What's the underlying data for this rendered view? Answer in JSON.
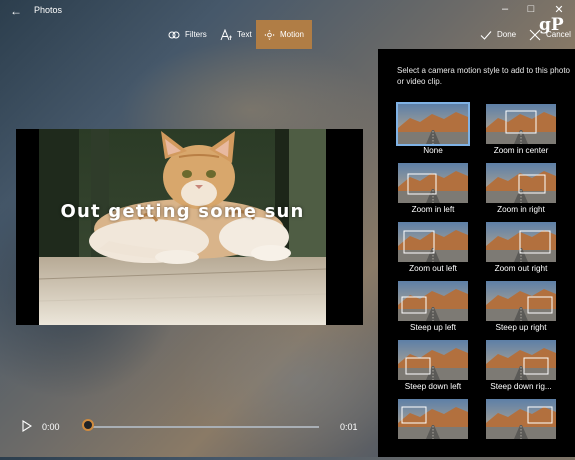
{
  "window": {
    "title": "Photos"
  },
  "toolbar": {
    "filters_label": "Filters",
    "text_label": "Text",
    "motion_label": "Motion",
    "done_label": "Done",
    "cancel_label": "Cancel",
    "accent_color": "#b07d45"
  },
  "watermark": "gP",
  "preview": {
    "caption": "Out getting some sun"
  },
  "player": {
    "current_time": "0:00",
    "total_time": "0:01",
    "progress": 0,
    "accent_color": "#d08b3e"
  },
  "motion_panel": {
    "description": "Select a camera motion style to add to this photo or video clip.",
    "options": [
      {
        "label": "None",
        "frame": "none"
      },
      {
        "label": "Zoom in center",
        "frame": "zoom-in-center"
      },
      {
        "label": "Zoom in left",
        "frame": "zoom-in-left"
      },
      {
        "label": "Zoom in right",
        "frame": "zoom-in-right"
      },
      {
        "label": "Zoom out left",
        "frame": "zoom-out-left"
      },
      {
        "label": "Zoom out right",
        "frame": "zoom-out-right"
      },
      {
        "label": "Steep up left",
        "frame": "steep-up-left"
      },
      {
        "label": "Steep up right",
        "frame": "steep-up-right"
      },
      {
        "label": "Steep down left",
        "frame": "steep-down-left"
      },
      {
        "label": "Steep down rig...",
        "frame": "steep-down-right"
      },
      {
        "label": "",
        "frame": "row7-left"
      },
      {
        "label": "",
        "frame": "row7-right"
      }
    ]
  }
}
